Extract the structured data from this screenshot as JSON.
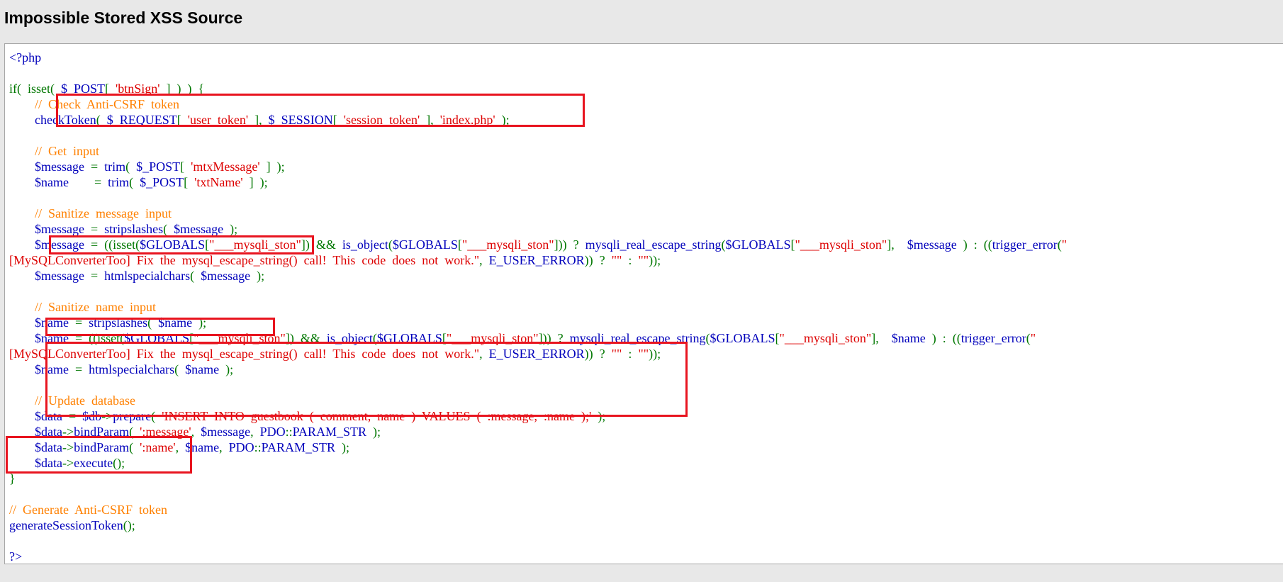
{
  "page": {
    "title": "Impossible Stored XSS Source"
  },
  "colors": {
    "html": "#0000bb",
    "default": "#007700",
    "keyword": "#0000bb",
    "string": "#dd0000",
    "comment": "#ff8000",
    "highlight_box": "#e8141f",
    "page_background": "#e8e8e8",
    "panel_background": "#ffffff",
    "panel_border": "#a7a7a7"
  },
  "code": {
    "lines": [
      [
        {
          "t": "html",
          "s": "<?php"
        }
      ],
      [],
      [
        {
          "t": "default",
          "s": "if(  isset(  "
        },
        {
          "t": "keyword",
          "s": "$_POST"
        },
        {
          "t": "default",
          "s": "[  "
        },
        {
          "t": "string",
          "s": "'btnSign'"
        },
        {
          "t": "default",
          "s": "  ]  )  )  {"
        }
      ],
      [
        {
          "t": "default",
          "s": "        "
        },
        {
          "t": "comment",
          "s": "//  Check  Anti-CSRF  token"
        }
      ],
      [
        {
          "t": "default",
          "s": "        "
        },
        {
          "t": "keyword",
          "s": "checkToken"
        },
        {
          "t": "default",
          "s": "(  "
        },
        {
          "t": "keyword",
          "s": "$_REQUEST"
        },
        {
          "t": "default",
          "s": "[  "
        },
        {
          "t": "string",
          "s": "'user_token'"
        },
        {
          "t": "default",
          "s": "  ],  "
        },
        {
          "t": "keyword",
          "s": "$_SESSION"
        },
        {
          "t": "default",
          "s": "[  "
        },
        {
          "t": "string",
          "s": "'session_token'"
        },
        {
          "t": "default",
          "s": "  ],  "
        },
        {
          "t": "string",
          "s": "'index.php'"
        },
        {
          "t": "default",
          "s": "  );"
        }
      ],
      [],
      [
        {
          "t": "default",
          "s": "        "
        },
        {
          "t": "comment",
          "s": "//  Get  input"
        }
      ],
      [
        {
          "t": "default",
          "s": "        "
        },
        {
          "t": "keyword",
          "s": "$message"
        },
        {
          "t": "default",
          "s": "  =  "
        },
        {
          "t": "keyword",
          "s": "trim"
        },
        {
          "t": "default",
          "s": "(  "
        },
        {
          "t": "keyword",
          "s": "$_POST"
        },
        {
          "t": "default",
          "s": "[  "
        },
        {
          "t": "string",
          "s": "'mtxMessage'"
        },
        {
          "t": "default",
          "s": "  ]  );"
        }
      ],
      [
        {
          "t": "default",
          "s": "        "
        },
        {
          "t": "keyword",
          "s": "$name"
        },
        {
          "t": "default",
          "s": "        =  "
        },
        {
          "t": "keyword",
          "s": "trim"
        },
        {
          "t": "default",
          "s": "(  "
        },
        {
          "t": "keyword",
          "s": "$_POST"
        },
        {
          "t": "default",
          "s": "[  "
        },
        {
          "t": "string",
          "s": "'txtName'"
        },
        {
          "t": "default",
          "s": "  ]  );"
        }
      ],
      [],
      [
        {
          "t": "default",
          "s": "        "
        },
        {
          "t": "comment",
          "s": "//  Sanitize  message  input"
        }
      ],
      [
        {
          "t": "default",
          "s": "        "
        },
        {
          "t": "keyword",
          "s": "$message"
        },
        {
          "t": "default",
          "s": "  =  "
        },
        {
          "t": "keyword",
          "s": "stripslashes"
        },
        {
          "t": "default",
          "s": "(  "
        },
        {
          "t": "keyword",
          "s": "$message"
        },
        {
          "t": "default",
          "s": "  );"
        }
      ],
      [
        {
          "t": "default",
          "s": "        "
        },
        {
          "t": "keyword",
          "s": "$message"
        },
        {
          "t": "default",
          "s": "  =  ((isset("
        },
        {
          "t": "keyword",
          "s": "$GLOBALS"
        },
        {
          "t": "default",
          "s": "["
        },
        {
          "t": "string",
          "s": "\"___mysqli_ston\""
        },
        {
          "t": "default",
          "s": "])  &&  "
        },
        {
          "t": "keyword",
          "s": "is_object"
        },
        {
          "t": "default",
          "s": "("
        },
        {
          "t": "keyword",
          "s": "$GLOBALS"
        },
        {
          "t": "default",
          "s": "["
        },
        {
          "t": "string",
          "s": "\"___mysqli_ston\""
        },
        {
          "t": "default",
          "s": "]))  ?  "
        },
        {
          "t": "keyword",
          "s": "mysqli_real_escape_string"
        },
        {
          "t": "default",
          "s": "("
        },
        {
          "t": "keyword",
          "s": "$GLOBALS"
        },
        {
          "t": "default",
          "s": "["
        },
        {
          "t": "string",
          "s": "\"___mysqli_ston\""
        },
        {
          "t": "default",
          "s": "],    "
        },
        {
          "t": "keyword",
          "s": "$message"
        },
        {
          "t": "default",
          "s": "  )  :  (("
        },
        {
          "t": "keyword",
          "s": "trigger_error"
        },
        {
          "t": "default",
          "s": "("
        },
        {
          "t": "string",
          "s": "\""
        }
      ],
      [
        {
          "t": "string",
          "s": "[MySQLConverterToo]  Fix  the  mysql_escape_string()  call!  This  code  does  not  work.\""
        },
        {
          "t": "default",
          "s": ",  "
        },
        {
          "t": "keyword",
          "s": "E_USER_ERROR"
        },
        {
          "t": "default",
          "s": "))  ?  "
        },
        {
          "t": "string",
          "s": "\"\""
        },
        {
          "t": "default",
          "s": "  :  "
        },
        {
          "t": "string",
          "s": "\"\""
        },
        {
          "t": "default",
          "s": "));"
        }
      ],
      [
        {
          "t": "default",
          "s": "        "
        },
        {
          "t": "keyword",
          "s": "$message"
        },
        {
          "t": "default",
          "s": "  =  "
        },
        {
          "t": "keyword",
          "s": "htmlspecialchars"
        },
        {
          "t": "default",
          "s": "(  "
        },
        {
          "t": "keyword",
          "s": "$message"
        },
        {
          "t": "default",
          "s": "  );"
        }
      ],
      [],
      [
        {
          "t": "default",
          "s": "        "
        },
        {
          "t": "comment",
          "s": "//  Sanitize  name  input"
        }
      ],
      [
        {
          "t": "default",
          "s": "        "
        },
        {
          "t": "keyword",
          "s": "$name"
        },
        {
          "t": "default",
          "s": "  =  "
        },
        {
          "t": "keyword",
          "s": "stripslashes"
        },
        {
          "t": "default",
          "s": "(  "
        },
        {
          "t": "keyword",
          "s": "$name"
        },
        {
          "t": "default",
          "s": "  );"
        }
      ],
      [
        {
          "t": "default",
          "s": "        "
        },
        {
          "t": "keyword",
          "s": "$name"
        },
        {
          "t": "default",
          "s": "  =  ((isset("
        },
        {
          "t": "keyword",
          "s": "$GLOBALS"
        },
        {
          "t": "default",
          "s": "["
        },
        {
          "t": "string",
          "s": "\"___mysqli_ston\""
        },
        {
          "t": "default",
          "s": "])  &&  "
        },
        {
          "t": "keyword",
          "s": "is_object"
        },
        {
          "t": "default",
          "s": "("
        },
        {
          "t": "keyword",
          "s": "$GLOBALS"
        },
        {
          "t": "default",
          "s": "["
        },
        {
          "t": "string",
          "s": "\"___mysqli_ston\""
        },
        {
          "t": "default",
          "s": "]))  ?  "
        },
        {
          "t": "keyword",
          "s": "mysqli_real_escape_string"
        },
        {
          "t": "default",
          "s": "("
        },
        {
          "t": "keyword",
          "s": "$GLOBALS"
        },
        {
          "t": "default",
          "s": "["
        },
        {
          "t": "string",
          "s": "\"___mysqli_ston\""
        },
        {
          "t": "default",
          "s": "],    "
        },
        {
          "t": "keyword",
          "s": "$name"
        },
        {
          "t": "default",
          "s": "  )  :  (("
        },
        {
          "t": "keyword",
          "s": "trigger_error"
        },
        {
          "t": "default",
          "s": "("
        },
        {
          "t": "string",
          "s": "\""
        }
      ],
      [
        {
          "t": "string",
          "s": "[MySQLConverterToo]  Fix  the  mysql_escape_string()  call!  This  code  does  not  work.\""
        },
        {
          "t": "default",
          "s": ",  "
        },
        {
          "t": "keyword",
          "s": "E_USER_ERROR"
        },
        {
          "t": "default",
          "s": "))  ?  "
        },
        {
          "t": "string",
          "s": "\"\""
        },
        {
          "t": "default",
          "s": "  :  "
        },
        {
          "t": "string",
          "s": "\"\""
        },
        {
          "t": "default",
          "s": "));"
        }
      ],
      [
        {
          "t": "default",
          "s": "        "
        },
        {
          "t": "keyword",
          "s": "$name"
        },
        {
          "t": "default",
          "s": "  =  "
        },
        {
          "t": "keyword",
          "s": "htmlspecialchars"
        },
        {
          "t": "default",
          "s": "(  "
        },
        {
          "t": "keyword",
          "s": "$name"
        },
        {
          "t": "default",
          "s": "  );"
        }
      ],
      [],
      [
        {
          "t": "default",
          "s": "        "
        },
        {
          "t": "comment",
          "s": "//  Update  database"
        }
      ],
      [
        {
          "t": "default",
          "s": "        "
        },
        {
          "t": "keyword",
          "s": "$data"
        },
        {
          "t": "default",
          "s": "  =  "
        },
        {
          "t": "keyword",
          "s": "$db"
        },
        {
          "t": "default",
          "s": "->"
        },
        {
          "t": "keyword",
          "s": "prepare"
        },
        {
          "t": "default",
          "s": "(  "
        },
        {
          "t": "string",
          "s": "'INSERT  INTO  guestbook  (  comment,  name  )  VALUES  (  :message,  :name  );'"
        },
        {
          "t": "default",
          "s": "  );"
        }
      ],
      [
        {
          "t": "default",
          "s": "        "
        },
        {
          "t": "keyword",
          "s": "$data"
        },
        {
          "t": "default",
          "s": "->"
        },
        {
          "t": "keyword",
          "s": "bindParam"
        },
        {
          "t": "default",
          "s": "(  "
        },
        {
          "t": "string",
          "s": "':message'"
        },
        {
          "t": "default",
          "s": ",  "
        },
        {
          "t": "keyword",
          "s": "$message"
        },
        {
          "t": "default",
          "s": ",  "
        },
        {
          "t": "keyword",
          "s": "PDO"
        },
        {
          "t": "default",
          "s": "::"
        },
        {
          "t": "keyword",
          "s": "PARAM_STR"
        },
        {
          "t": "default",
          "s": "  );"
        }
      ],
      [
        {
          "t": "default",
          "s": "        "
        },
        {
          "t": "keyword",
          "s": "$data"
        },
        {
          "t": "default",
          "s": "->"
        },
        {
          "t": "keyword",
          "s": "bindParam"
        },
        {
          "t": "default",
          "s": "(  "
        },
        {
          "t": "string",
          "s": "':name'"
        },
        {
          "t": "default",
          "s": ",  "
        },
        {
          "t": "keyword",
          "s": "$name"
        },
        {
          "t": "default",
          "s": ",  "
        },
        {
          "t": "keyword",
          "s": "PDO"
        },
        {
          "t": "default",
          "s": "::"
        },
        {
          "t": "keyword",
          "s": "PARAM_STR"
        },
        {
          "t": "default",
          "s": "  );"
        }
      ],
      [
        {
          "t": "default",
          "s": "        "
        },
        {
          "t": "keyword",
          "s": "$data"
        },
        {
          "t": "default",
          "s": "->"
        },
        {
          "t": "keyword",
          "s": "execute"
        },
        {
          "t": "default",
          "s": "();"
        }
      ],
      [
        {
          "t": "default",
          "s": "}"
        }
      ],
      [],
      [
        {
          "t": "comment",
          "s": "//  Generate  Anti-CSRF  token"
        }
      ],
      [
        {
          "t": "keyword",
          "s": "generateSessionToken"
        },
        {
          "t": "default",
          "s": "();"
        }
      ],
      [],
      [
        {
          "t": "html",
          "s": "?>"
        }
      ]
    ]
  }
}
